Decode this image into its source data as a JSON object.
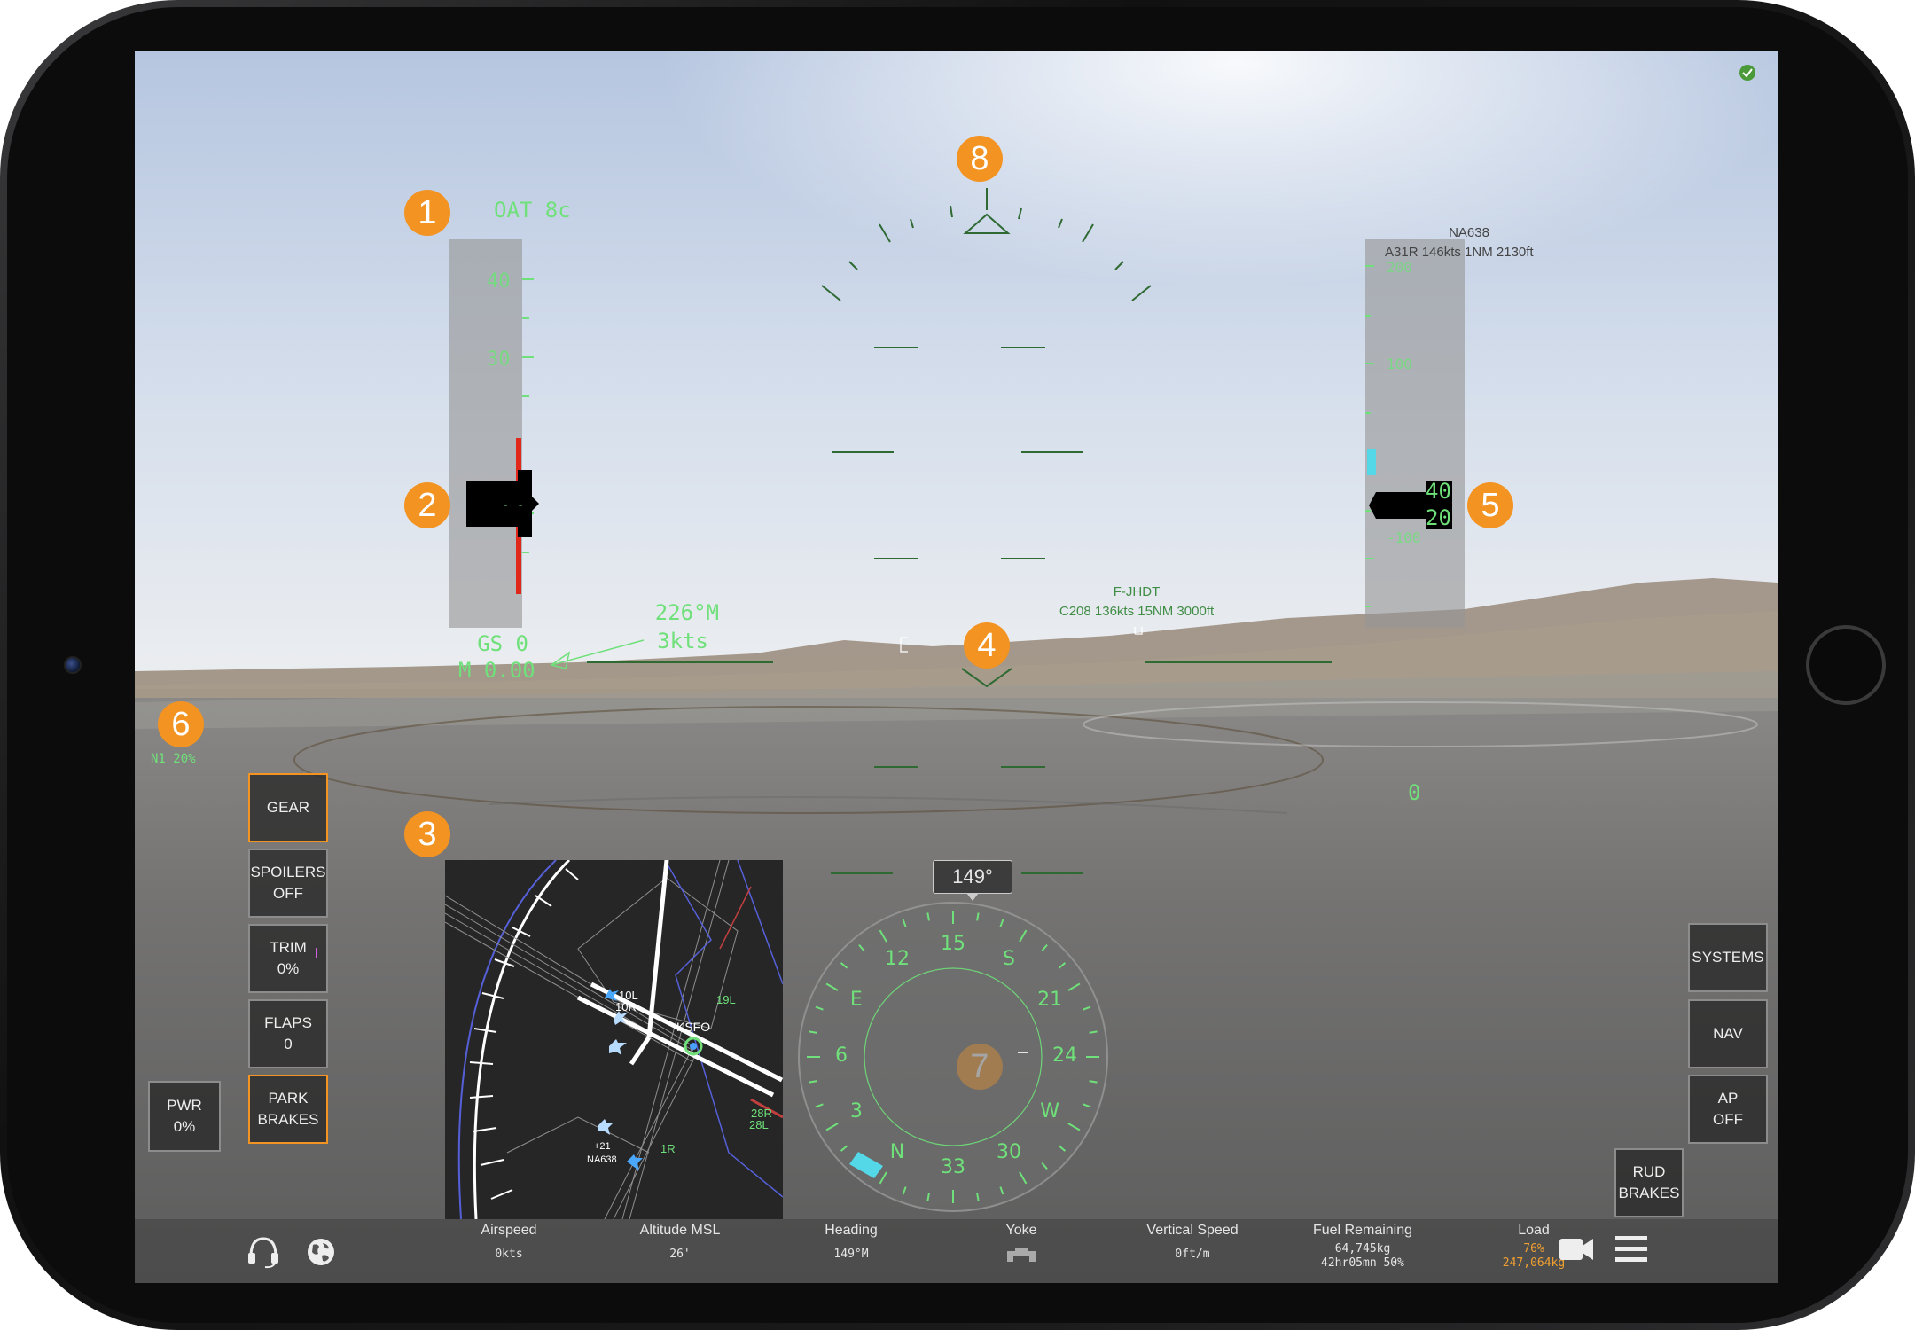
{
  "speed_tape": {
    "oat": "OAT 8c",
    "ticks": [
      "40",
      "30"
    ],
    "gs": "GS 0",
    "mach": "M 0.00"
  },
  "wind": {
    "direction": "226°M",
    "speed": "3kts"
  },
  "alt_tape": {
    "traffic_id": "NA638",
    "traffic_info": "A31R 146kts 1NM 2130ft",
    "ticks": [
      "200",
      "100",
      "0",
      "-100"
    ],
    "readout_top": "40",
    "readout_bottom": "20",
    "bottom_value": "0"
  },
  "hud_traffic": {
    "id": "F-JHDT",
    "info": "C208 136kts 15NM 3000ft"
  },
  "markers": [
    "1",
    "2",
    "3",
    "4",
    "5",
    "6",
    "7",
    "8"
  ],
  "n1": "N1  20%",
  "left_buttons": {
    "gear": "GEAR",
    "spoilers": [
      "SPOILERS",
      "OFF"
    ],
    "trim": [
      "TRIM",
      "0%"
    ],
    "flaps": [
      "FLAPS",
      "0"
    ],
    "park": [
      "PARK",
      "BRAKES"
    ],
    "pwr": [
      "PWR",
      "0%"
    ]
  },
  "right_buttons": {
    "systems": "SYSTEMS",
    "nav": "NAV",
    "ap": [
      "AP",
      "OFF"
    ],
    "rud": [
      "RUD",
      "BRAKES"
    ]
  },
  "map": {
    "airport": "KSFO",
    "runways": [
      "10L",
      "10R",
      "19L",
      "28R",
      "28L",
      "1R"
    ],
    "traffic_alt": "+21",
    "traffic_id": "NA638"
  },
  "compass": {
    "heading_box": "149°",
    "labels": [
      "15",
      "S",
      "21",
      "24",
      "W",
      "30",
      "33",
      "N",
      "3",
      "6",
      "E",
      "12"
    ]
  },
  "bottom_bar": {
    "airspeed": {
      "label": "Airspeed",
      "value": "0kts"
    },
    "altitude": {
      "label": "Altitude MSL",
      "value": "26'"
    },
    "heading": {
      "label": "Heading",
      "value": "149°M"
    },
    "yoke": {
      "label": "Yoke"
    },
    "vs": {
      "label": "Vertical Speed",
      "value": "0ft/m"
    },
    "fuel": {
      "label": "Fuel Remaining",
      "value": "64,745kg",
      "value2": "42hr05mn 50%"
    },
    "load": {
      "label": "Load",
      "value": "76%",
      "value2": "247,064kg"
    }
  },
  "icons": [
    "headset-icon",
    "globe-icon",
    "yoke-icon",
    "camera-icon",
    "menu-icon",
    "status-check-icon"
  ],
  "colors": {
    "hud_green": "#6fe07a",
    "marker_orange": "#f39321",
    "warning_red": "#e0281a",
    "cyan": "#54d8e8",
    "load_orange": "#f0a030"
  }
}
